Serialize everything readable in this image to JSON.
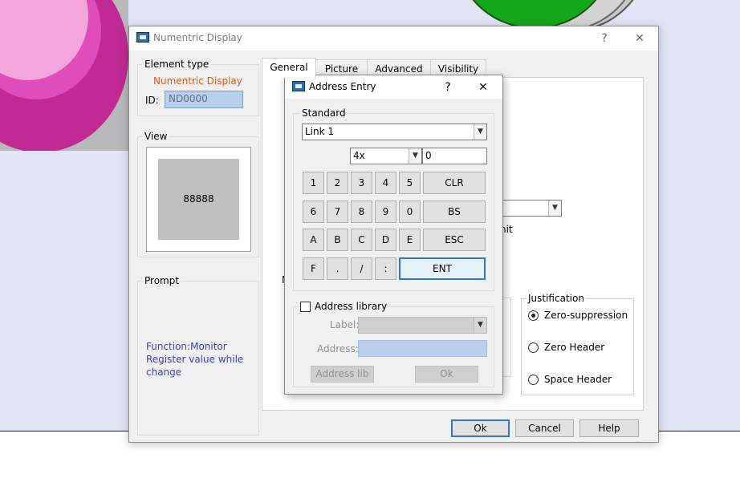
{
  "main_window": {
    "title": "Numentric Display",
    "help_icon": "?",
    "close_icon": "✕",
    "element_type_label": "Element type",
    "element_type_value": "Numentric Display",
    "id_label": "ID:",
    "id_value": "ND0000",
    "view_label": "View",
    "view_preview_value": "88888",
    "prompt_label": "Prompt",
    "prompt_text": "Function:Monitor Register value while change",
    "tabs": [
      {
        "label": "General"
      },
      {
        "label": "Picture"
      },
      {
        "label": "Advanced"
      },
      {
        "label": "Visibility"
      }
    ],
    "partial_unit_text": "nit",
    "partial_n_text": "N",
    "justification": {
      "label": "Justification",
      "options": [
        {
          "label": "Zero-suppression",
          "checked": true
        },
        {
          "label": "Zero Header",
          "checked": false
        },
        {
          "label": "Space Header",
          "checked": false
        }
      ]
    },
    "buttons": {
      "ok": "Ok",
      "cancel": "Cancel",
      "help": "Help"
    }
  },
  "address_dialog": {
    "title": "Address Entry",
    "help_icon": "?",
    "close_icon": "✕",
    "standard_label": "Standard",
    "link_value": "Link 1",
    "register_type": "4x",
    "address_value": "0",
    "keypad": [
      [
        "1",
        "2",
        "3",
        "4",
        "5",
        "CLR"
      ],
      [
        "6",
        "7",
        "8",
        "9",
        "0",
        "BS"
      ],
      [
        "A",
        "B",
        "C",
        "D",
        "E",
        "ESC"
      ],
      [
        "F",
        ".",
        "/",
        ":",
        "ENT"
      ]
    ],
    "address_library_label": "Address library",
    "address_library_checked": false,
    "label_field_label": "Label:",
    "label_field_value": "",
    "address_field_label": "Address:",
    "address_field_value": "",
    "address_lib_button": "Address lib",
    "ok_button": "Ok"
  }
}
